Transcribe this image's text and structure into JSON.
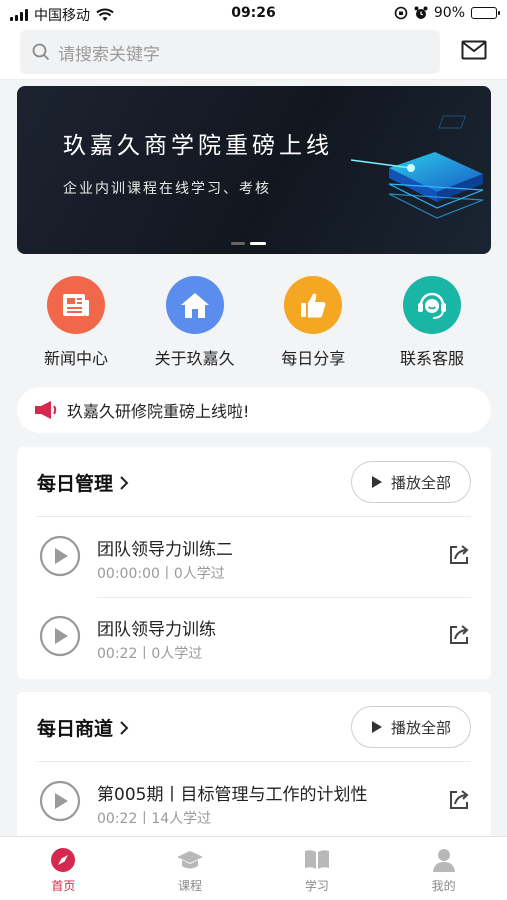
{
  "status_bar": {
    "carrier": "中国移动",
    "time": "09:26",
    "battery": "90%",
    "battery_level": 0.9
  },
  "search": {
    "placeholder": "请搜索关键字"
  },
  "banner": {
    "title": "玖嘉久商学院重磅上线",
    "subtitle": "企业内训课程在线学习、考核"
  },
  "quick_links": [
    {
      "label": "新闻中心",
      "icon": "news-icon",
      "color": "#f0674a"
    },
    {
      "label": "关于玖嘉久",
      "icon": "home-icon",
      "color": "#5b8def"
    },
    {
      "label": "每日分享",
      "icon": "thumbs-up-icon",
      "color": "#f5a623"
    },
    {
      "label": "联系客服",
      "icon": "customer-service-icon",
      "color": "#19b5a5"
    }
  ],
  "notice": {
    "text": "玖嘉久研修院重磅上线啦!"
  },
  "sections": [
    {
      "title": "每日管理",
      "play_all": "播放全部",
      "items": [
        {
          "title": "团队领导力训练二",
          "meta": "00:00:00丨0人学过"
        },
        {
          "title": "团队领导力训练",
          "meta": "00:22丨0人学过"
        }
      ]
    },
    {
      "title": "每日商道",
      "play_all": "播放全部",
      "items": [
        {
          "title": "第005期丨目标管理与工作的计划性",
          "meta": "00:22丨14人学过"
        }
      ]
    }
  ],
  "tabs": [
    {
      "label": "首页",
      "icon": "compass-icon",
      "active": true
    },
    {
      "label": "课程",
      "icon": "graduation-cap-icon",
      "active": false
    },
    {
      "label": "学习",
      "icon": "book-icon",
      "active": false
    },
    {
      "label": "我的",
      "icon": "user-icon",
      "active": false
    }
  ],
  "colors": {
    "accent": "#d4284e",
    "speaker": "#d4284e"
  }
}
